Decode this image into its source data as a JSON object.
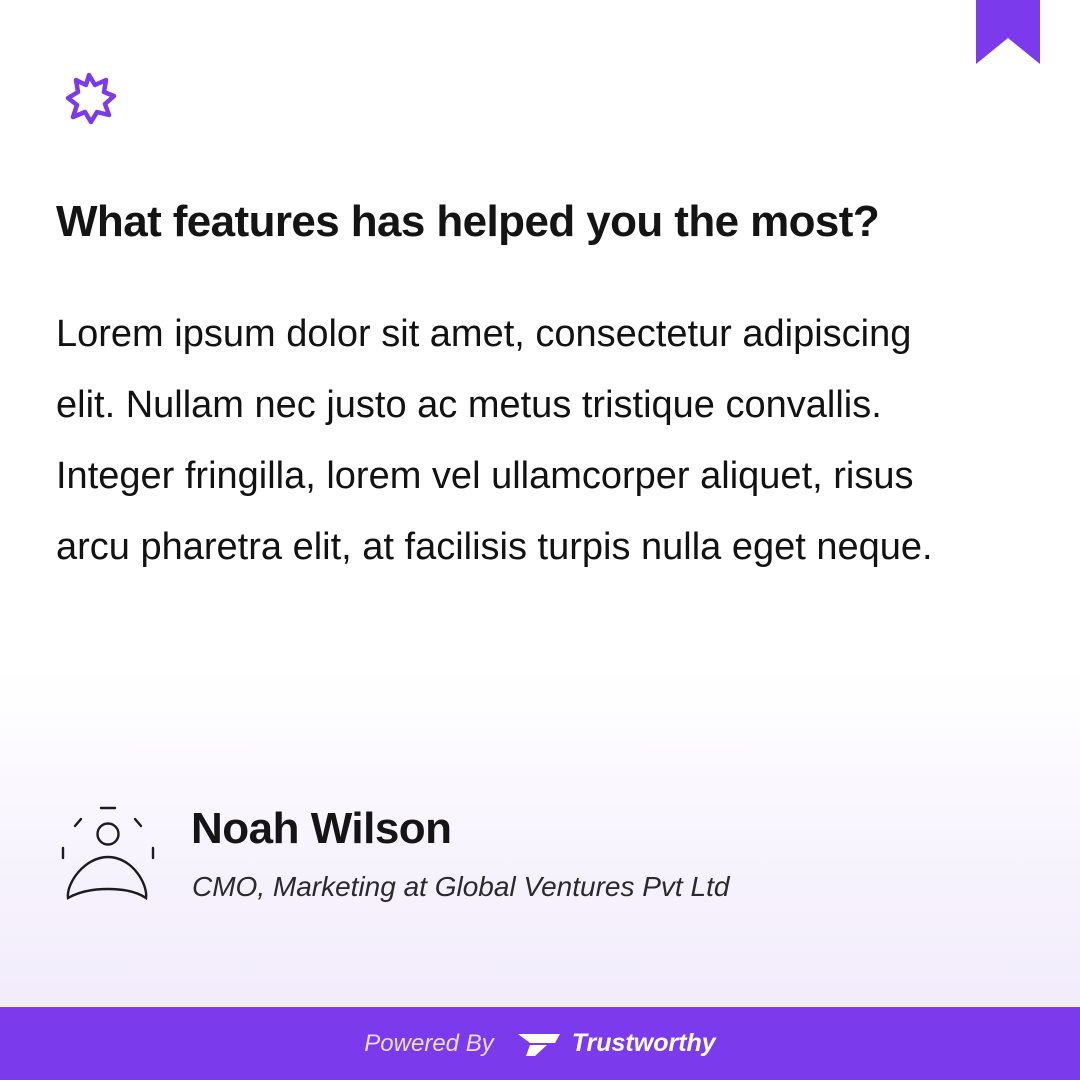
{
  "card": {
    "question": "What features has helped you the most?",
    "answer": "Lorem ipsum dolor sit amet, consectetur adipiscing elit. Nullam nec justo ac metus tristique convallis. Integer fringilla, lorem vel ullamcorper aliquet, risus arcu pharetra elit, at facilisis turpis nulla eget neque."
  },
  "author": {
    "name": "Noah Wilson",
    "role": "CMO, Marketing at Global Ventures Pvt Ltd"
  },
  "footer": {
    "powered_by": "Powered By",
    "brand": "Trustworthy"
  },
  "icons": {
    "corner": "bookmark-icon",
    "brand": "starburst-icon",
    "avatar": "user-placeholder-icon",
    "footer_logo": "trustworthy-logo-icon"
  },
  "colors": {
    "accent": "#7c3aed",
    "text": "#111111"
  }
}
